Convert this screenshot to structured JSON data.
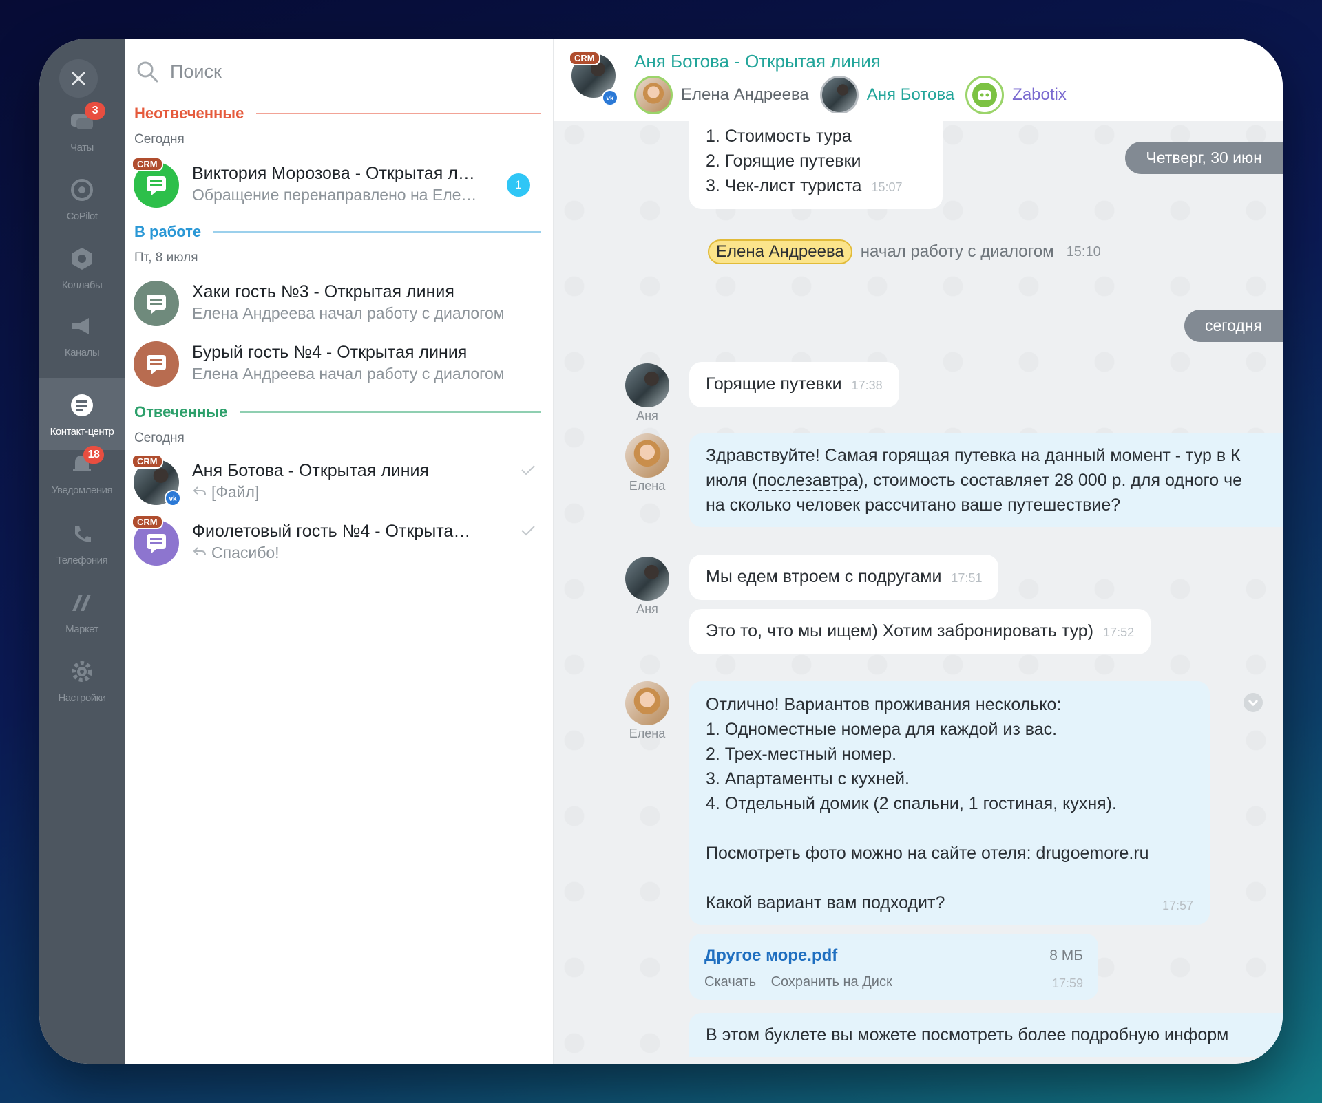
{
  "nav": {
    "items": [
      {
        "label": "Чаты",
        "badge": "3"
      },
      {
        "label": "CoPilot"
      },
      {
        "label": "Коллабы"
      },
      {
        "label": "Каналы"
      },
      {
        "label": "Контакт-центр"
      },
      {
        "label": "Уведомления",
        "badge": "18"
      },
      {
        "label": "Телефония"
      },
      {
        "label": "Маркет"
      },
      {
        "label": "Настройки"
      }
    ]
  },
  "list": {
    "search_placeholder": "Поиск",
    "crm_tag": "CRM",
    "sections": {
      "unanswered": {
        "title": "Неотвеченные",
        "date": "Сегодня",
        "color": "#e55a3c"
      },
      "in_work": {
        "title": "В работе",
        "date": "Пт, 8 июля",
        "color": "#2b98d6"
      },
      "answered": {
        "title": "Отвеченные",
        "date": "Сегодня",
        "color": "#2da06b"
      }
    },
    "chats": [
      {
        "title": "Виктория Морозова - Открытая л…",
        "sub": "Обращение перенаправлено на Еле…",
        "unread": "1"
      },
      {
        "title": "Хаки гость №3 - Открытая линия",
        "sub": "Елена Андреева начал работу с диалогом"
      },
      {
        "title": "Бурый гость №4 - Открытая линия",
        "sub": "Елена Андреева начал работу с диалогом"
      },
      {
        "title": "Аня Ботова - Открытая линия",
        "sub": "[Файл]"
      },
      {
        "title": "Фиолетовый гость №4 - Открыта…",
        "sub": "Спасибо!"
      }
    ]
  },
  "header": {
    "title": "Аня Ботова - Открытая линия",
    "participants": [
      "Елена Андреева",
      "Аня Ботова",
      "Zabotix"
    ]
  },
  "messages": {
    "prev_list": [
      "1. Стоимость тура",
      "2. Горящие путевки",
      "3. Чек-лист туриста"
    ],
    "prev_time": "15:07",
    "date_thursday": "Четверг, 30 июн",
    "system_name": "Елена Андреева",
    "system_text": "начал работу с диалогом",
    "system_time": "15:10",
    "date_today": "сегодня",
    "m1": {
      "text": "Горящие путевки",
      "time": "17:38",
      "sender": "Аня"
    },
    "m2": {
      "line1": "Здравствуйте! Самая горящая путевка на данный момент - тур в К",
      "line2_a": "июля (",
      "line2_link": "послезавтра",
      "line2_b": "), стоимость составляет 28 000 р. для одного че",
      "line3": "на сколько человек рассчитано ваше путешествие?",
      "sender": "Елена"
    },
    "m3": {
      "text": "Мы едем втроем с подругами",
      "time": "17:51",
      "sender": "Аня"
    },
    "m4": {
      "text": "Это то, что мы ищем) Хотим забронировать тур)",
      "time": "17:52"
    },
    "m5": {
      "lines": [
        "Отлично! Вариантов проживания несколько:",
        "1. Одноместные номера для каждой из вас.",
        "2. Трех-местный номер.",
        "3. Апартаменты с кухней.",
        "4. Отдельный домик (2 спальни, 1 гостиная, кухня)."
      ],
      "photo_line": "Посмотреть фото можно на сайте отеля: drugoemore.ru",
      "question": "Какой вариант вам подходит?",
      "time": "17:57",
      "sender": "Елена"
    },
    "file": {
      "name": "Другое море.pdf",
      "size": "8 МБ",
      "download": "Скачать",
      "save": "Сохранить на Диск",
      "time": "17:59"
    },
    "m6": {
      "text": "В этом буклете вы можете посмотреть более подробную информ"
    }
  }
}
